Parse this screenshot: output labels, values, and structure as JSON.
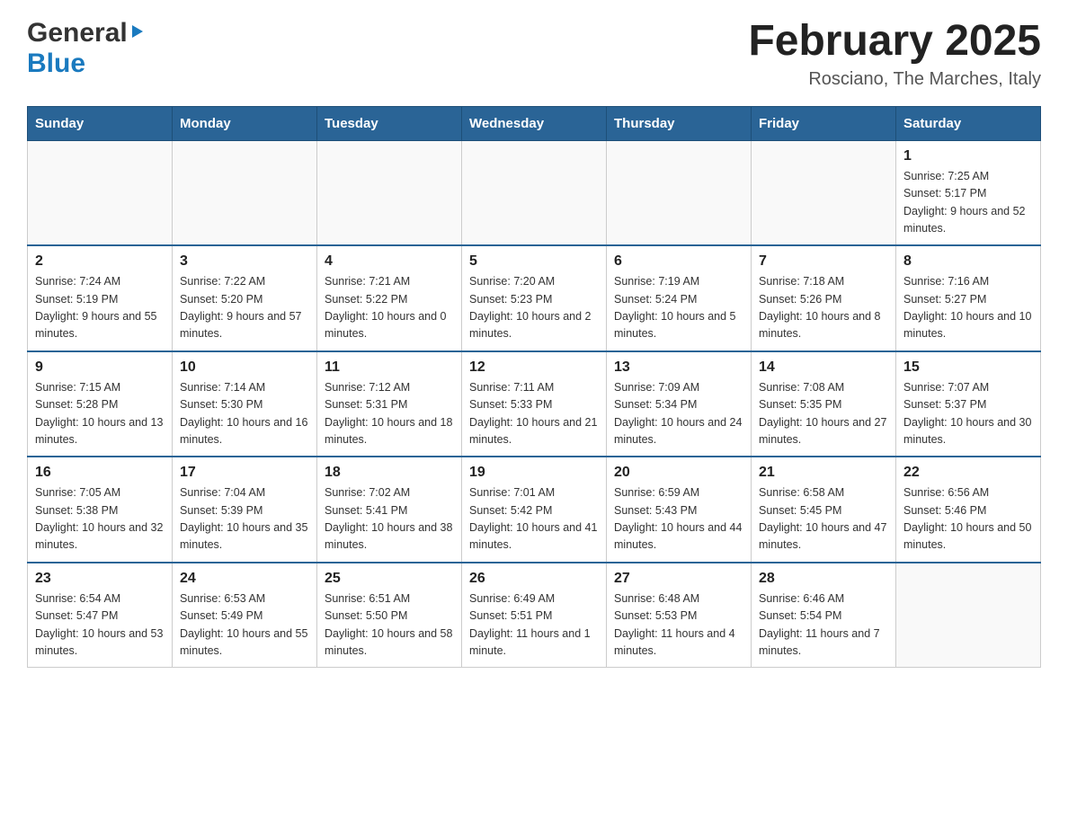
{
  "header": {
    "logo_general": "General",
    "logo_blue": "Blue",
    "title": "February 2025",
    "subtitle": "Rosciano, The Marches, Italy"
  },
  "weekdays": [
    "Sunday",
    "Monday",
    "Tuesday",
    "Wednesday",
    "Thursday",
    "Friday",
    "Saturday"
  ],
  "weeks": [
    [
      {
        "day": "",
        "sunrise": "",
        "sunset": "",
        "daylight": ""
      },
      {
        "day": "",
        "sunrise": "",
        "sunset": "",
        "daylight": ""
      },
      {
        "day": "",
        "sunrise": "",
        "sunset": "",
        "daylight": ""
      },
      {
        "day": "",
        "sunrise": "",
        "sunset": "",
        "daylight": ""
      },
      {
        "day": "",
        "sunrise": "",
        "sunset": "",
        "daylight": ""
      },
      {
        "day": "",
        "sunrise": "",
        "sunset": "",
        "daylight": ""
      },
      {
        "day": "1",
        "sunrise": "Sunrise: 7:25 AM",
        "sunset": "Sunset: 5:17 PM",
        "daylight": "Daylight: 9 hours and 52 minutes."
      }
    ],
    [
      {
        "day": "2",
        "sunrise": "Sunrise: 7:24 AM",
        "sunset": "Sunset: 5:19 PM",
        "daylight": "Daylight: 9 hours and 55 minutes."
      },
      {
        "day": "3",
        "sunrise": "Sunrise: 7:22 AM",
        "sunset": "Sunset: 5:20 PM",
        "daylight": "Daylight: 9 hours and 57 minutes."
      },
      {
        "day": "4",
        "sunrise": "Sunrise: 7:21 AM",
        "sunset": "Sunset: 5:22 PM",
        "daylight": "Daylight: 10 hours and 0 minutes."
      },
      {
        "day": "5",
        "sunrise": "Sunrise: 7:20 AM",
        "sunset": "Sunset: 5:23 PM",
        "daylight": "Daylight: 10 hours and 2 minutes."
      },
      {
        "day": "6",
        "sunrise": "Sunrise: 7:19 AM",
        "sunset": "Sunset: 5:24 PM",
        "daylight": "Daylight: 10 hours and 5 minutes."
      },
      {
        "day": "7",
        "sunrise": "Sunrise: 7:18 AM",
        "sunset": "Sunset: 5:26 PM",
        "daylight": "Daylight: 10 hours and 8 minutes."
      },
      {
        "day": "8",
        "sunrise": "Sunrise: 7:16 AM",
        "sunset": "Sunset: 5:27 PM",
        "daylight": "Daylight: 10 hours and 10 minutes."
      }
    ],
    [
      {
        "day": "9",
        "sunrise": "Sunrise: 7:15 AM",
        "sunset": "Sunset: 5:28 PM",
        "daylight": "Daylight: 10 hours and 13 minutes."
      },
      {
        "day": "10",
        "sunrise": "Sunrise: 7:14 AM",
        "sunset": "Sunset: 5:30 PM",
        "daylight": "Daylight: 10 hours and 16 minutes."
      },
      {
        "day": "11",
        "sunrise": "Sunrise: 7:12 AM",
        "sunset": "Sunset: 5:31 PM",
        "daylight": "Daylight: 10 hours and 18 minutes."
      },
      {
        "day": "12",
        "sunrise": "Sunrise: 7:11 AM",
        "sunset": "Sunset: 5:33 PM",
        "daylight": "Daylight: 10 hours and 21 minutes."
      },
      {
        "day": "13",
        "sunrise": "Sunrise: 7:09 AM",
        "sunset": "Sunset: 5:34 PM",
        "daylight": "Daylight: 10 hours and 24 minutes."
      },
      {
        "day": "14",
        "sunrise": "Sunrise: 7:08 AM",
        "sunset": "Sunset: 5:35 PM",
        "daylight": "Daylight: 10 hours and 27 minutes."
      },
      {
        "day": "15",
        "sunrise": "Sunrise: 7:07 AM",
        "sunset": "Sunset: 5:37 PM",
        "daylight": "Daylight: 10 hours and 30 minutes."
      }
    ],
    [
      {
        "day": "16",
        "sunrise": "Sunrise: 7:05 AM",
        "sunset": "Sunset: 5:38 PM",
        "daylight": "Daylight: 10 hours and 32 minutes."
      },
      {
        "day": "17",
        "sunrise": "Sunrise: 7:04 AM",
        "sunset": "Sunset: 5:39 PM",
        "daylight": "Daylight: 10 hours and 35 minutes."
      },
      {
        "day": "18",
        "sunrise": "Sunrise: 7:02 AM",
        "sunset": "Sunset: 5:41 PM",
        "daylight": "Daylight: 10 hours and 38 minutes."
      },
      {
        "day": "19",
        "sunrise": "Sunrise: 7:01 AM",
        "sunset": "Sunset: 5:42 PM",
        "daylight": "Daylight: 10 hours and 41 minutes."
      },
      {
        "day": "20",
        "sunrise": "Sunrise: 6:59 AM",
        "sunset": "Sunset: 5:43 PM",
        "daylight": "Daylight: 10 hours and 44 minutes."
      },
      {
        "day": "21",
        "sunrise": "Sunrise: 6:58 AM",
        "sunset": "Sunset: 5:45 PM",
        "daylight": "Daylight: 10 hours and 47 minutes."
      },
      {
        "day": "22",
        "sunrise": "Sunrise: 6:56 AM",
        "sunset": "Sunset: 5:46 PM",
        "daylight": "Daylight: 10 hours and 50 minutes."
      }
    ],
    [
      {
        "day": "23",
        "sunrise": "Sunrise: 6:54 AM",
        "sunset": "Sunset: 5:47 PM",
        "daylight": "Daylight: 10 hours and 53 minutes."
      },
      {
        "day": "24",
        "sunrise": "Sunrise: 6:53 AM",
        "sunset": "Sunset: 5:49 PM",
        "daylight": "Daylight: 10 hours and 55 minutes."
      },
      {
        "day": "25",
        "sunrise": "Sunrise: 6:51 AM",
        "sunset": "Sunset: 5:50 PM",
        "daylight": "Daylight: 10 hours and 58 minutes."
      },
      {
        "day": "26",
        "sunrise": "Sunrise: 6:49 AM",
        "sunset": "Sunset: 5:51 PM",
        "daylight": "Daylight: 11 hours and 1 minute."
      },
      {
        "day": "27",
        "sunrise": "Sunrise: 6:48 AM",
        "sunset": "Sunset: 5:53 PM",
        "daylight": "Daylight: 11 hours and 4 minutes."
      },
      {
        "day": "28",
        "sunrise": "Sunrise: 6:46 AM",
        "sunset": "Sunset: 5:54 PM",
        "daylight": "Daylight: 11 hours and 7 minutes."
      },
      {
        "day": "",
        "sunrise": "",
        "sunset": "",
        "daylight": ""
      }
    ]
  ]
}
